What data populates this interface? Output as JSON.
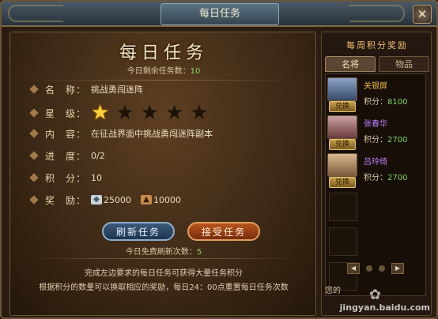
{
  "window": {
    "title": "每日任务",
    "close_glyph": "✕"
  },
  "main": {
    "heading": "每日任务",
    "remaining_label": "今日剩余任务数：",
    "remaining_value": "10",
    "fields": {
      "name_label": "名　称：",
      "name_value": "挑战勇闯迷阵",
      "star_label": "星　级：",
      "stars_filled": 1,
      "stars_total": 5,
      "content_label": "内　容：",
      "content_value": "在征战界面中挑战勇闯迷阵副本",
      "progress_label": "进　度：",
      "progress_value": "0/2",
      "points_label": "积　分：",
      "points_value": "10",
      "reward_label": "奖　励：",
      "rewards": [
        {
          "icon": "silver-icon",
          "value": "25000"
        },
        {
          "icon": "exp-icon",
          "value": "10000"
        }
      ]
    },
    "refresh_button": "刷新任务",
    "accept_button": "接受任务",
    "free_refresh_label": "今日免费刷新次数：",
    "free_refresh_value": "5",
    "note_line1": "完成左边要求的每日任务可获得大量任务积分",
    "note_line2": "根据积分的数量可以换取相应的奖励，每日24：00点重置每日任务次数"
  },
  "side": {
    "title": "每周积分奖励",
    "tabs": [
      "名将",
      "物品"
    ],
    "exchange_label": "兑换",
    "score_label": "积分：",
    "generals": [
      {
        "name": "关银屏",
        "score": "8100",
        "name_color": "#f0c040"
      },
      {
        "name": "张春华",
        "score": "2700",
        "name_color": "#c080ff"
      },
      {
        "name": "吕玲绮",
        "score": "2700",
        "name_color": "#c080ff"
      }
    ],
    "footer": "您的",
    "colors": {
      "active_tab": "#5a4632",
      "accent": "#f0c070"
    }
  },
  "watermark": "jingyan.baidu.com"
}
